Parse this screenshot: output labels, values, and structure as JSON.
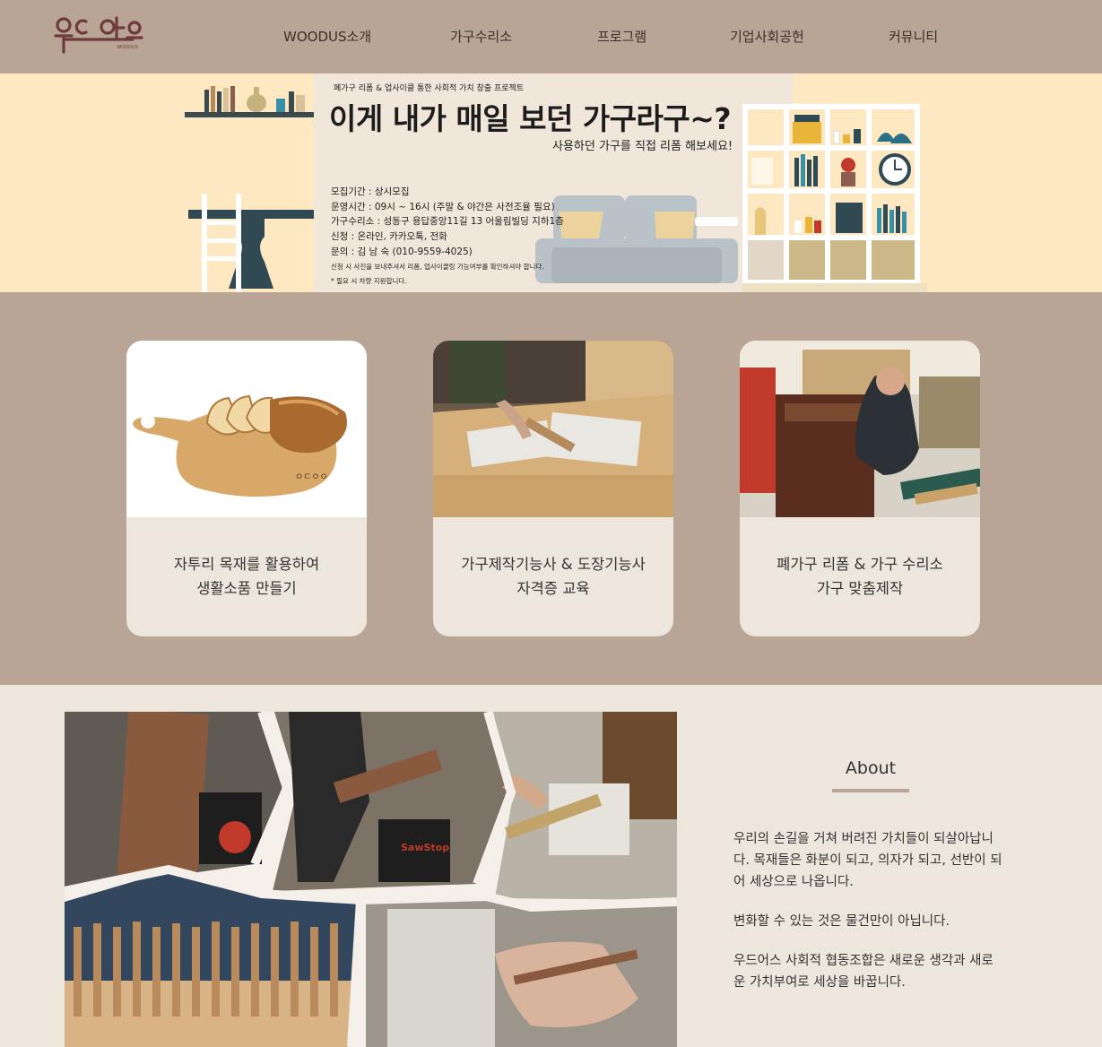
{
  "header": {
    "logo_alt": "우드어스",
    "logo_sub": "WOODUS",
    "nav": [
      "WOODUS소개",
      "가구수리소",
      "프로그램",
      "기업사회공헌",
      "커뮤니티"
    ]
  },
  "banner": {
    "subtitle": "폐가구 리폼 & 업사이클 통한 사회적 가치 창출 프로젝트",
    "title": "이게 내가 매일 보던 가구라구~?",
    "tagline": "사용하던 가구를 직접 리폼 해보세요!",
    "info": [
      "모집기간 : 상시모집",
      "운영시간 : 09시 ~ 16시 (주말 & 야간은 사전조율 필요)",
      "가구수리소 : 성동구 용답중앙11길 13 어울림빌딩 지하1층",
      "신청 : 온라인, 카카오톡, 전화",
      "문의 : 김 남 숙 (010-9559-4025)"
    ],
    "notes": [
      "신청 시 사진을 보내주셔서 리폼, 업사이클링 가능여부를 확인하셔야 합니다.",
      "* 필요 시 차량 지원합니다."
    ]
  },
  "cards": [
    {
      "line1": "자투리 목재를 활용하여",
      "line2": "생활소품 만들기"
    },
    {
      "line1": "가구제작기능사 & 도장기능사",
      "line2": "자격증 교육"
    },
    {
      "line1": "폐가구 리폼 & 가구 수리소",
      "line2": "가구 맞춤제작"
    }
  ],
  "about": {
    "title": "About",
    "p1": "우리의 손길을 거쳐 버려진 가치들이 되살아납니다. 목재들은 화분이 되고, 의자가 되고, 선반이 되어 세상으로 나옵니다.",
    "p2": "변화할 수 있는 것은 물건만이 아닙니다.",
    "p3": "우드어스 사회적 협동조합은 새로운 생각과 새로운 가치부여로 세상을 바꿉니다."
  },
  "colors": {
    "header_bg": "#b9a595",
    "banner_bg": "#fde8c2",
    "page_bg": "#ede6dc",
    "logo": "#6e3a3e"
  }
}
